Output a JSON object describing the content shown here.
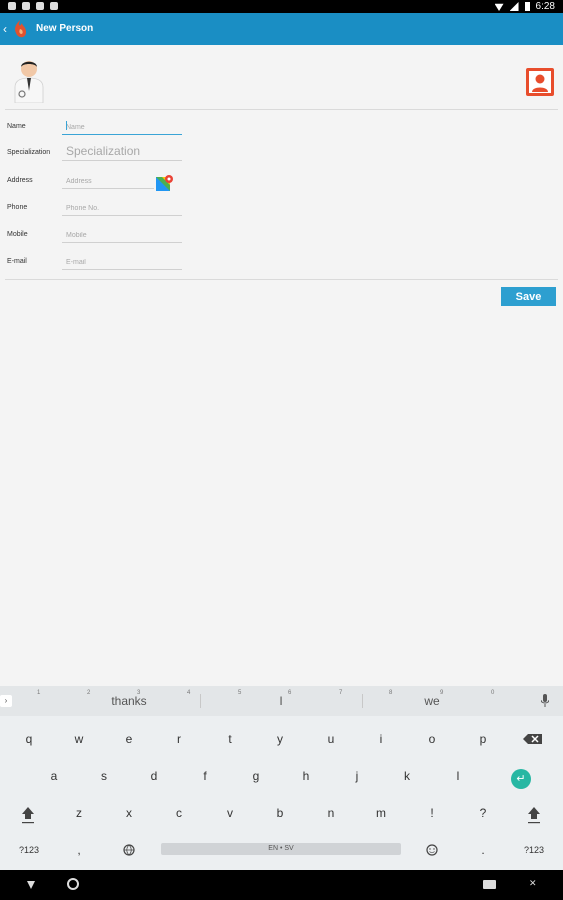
{
  "status_bar": {
    "time": "6:28"
  },
  "action_bar": {
    "back_glyph": "‹",
    "title": "New Person"
  },
  "form": {
    "name_label": "Name",
    "name_placeholder": "Name",
    "specialization_label": "Specialization",
    "specialization_placeholder": "Specialization",
    "address_label": "Address",
    "address_placeholder": "Address",
    "phone_label": "Phone",
    "phone_placeholder": "Phone No.",
    "mobile_label": "Mobile",
    "mobile_placeholder": "Mobile",
    "email_label": "E-mail",
    "email_placeholder": "E-mail",
    "save_label": "Save"
  },
  "keyboard": {
    "suggestions": [
      "thanks",
      "I",
      "we"
    ],
    "row1": [
      {
        "key": "q",
        "hint": "1"
      },
      {
        "key": "w",
        "hint": "2"
      },
      {
        "key": "e",
        "hint": "3"
      },
      {
        "key": "r",
        "hint": "4"
      },
      {
        "key": "t",
        "hint": "5"
      },
      {
        "key": "y",
        "hint": "6"
      },
      {
        "key": "u",
        "hint": "7"
      },
      {
        "key": "i",
        "hint": "8"
      },
      {
        "key": "o",
        "hint": "9"
      },
      {
        "key": "p",
        "hint": "0"
      }
    ],
    "row2": [
      "a",
      "s",
      "d",
      "f",
      "g",
      "h",
      "j",
      "k",
      "l"
    ],
    "row3": [
      "z",
      "x",
      "c",
      "v",
      "b",
      "n",
      "m",
      "!",
      "?"
    ],
    "symbols_label": "?123",
    "comma_label": ",",
    "period_label": ".",
    "space_label": "EN • SV",
    "symbols_label_right": "?123"
  },
  "icons": {
    "back": "back-arrow-icon",
    "logo": "app-logo-icon",
    "avatar": "person-avatar-icon",
    "contacts": "contacts-icon",
    "maps": "maps-icon",
    "mic": "mic-icon",
    "backspace": "backspace-icon",
    "shift": "shift-icon",
    "enter": "enter-icon",
    "globe": "globe-icon",
    "emoji": "emoji-icon"
  },
  "colors": {
    "action_bar": "#1a8ec4",
    "save_button": "#2d9fd0",
    "enter_key": "#27b7a3"
  }
}
